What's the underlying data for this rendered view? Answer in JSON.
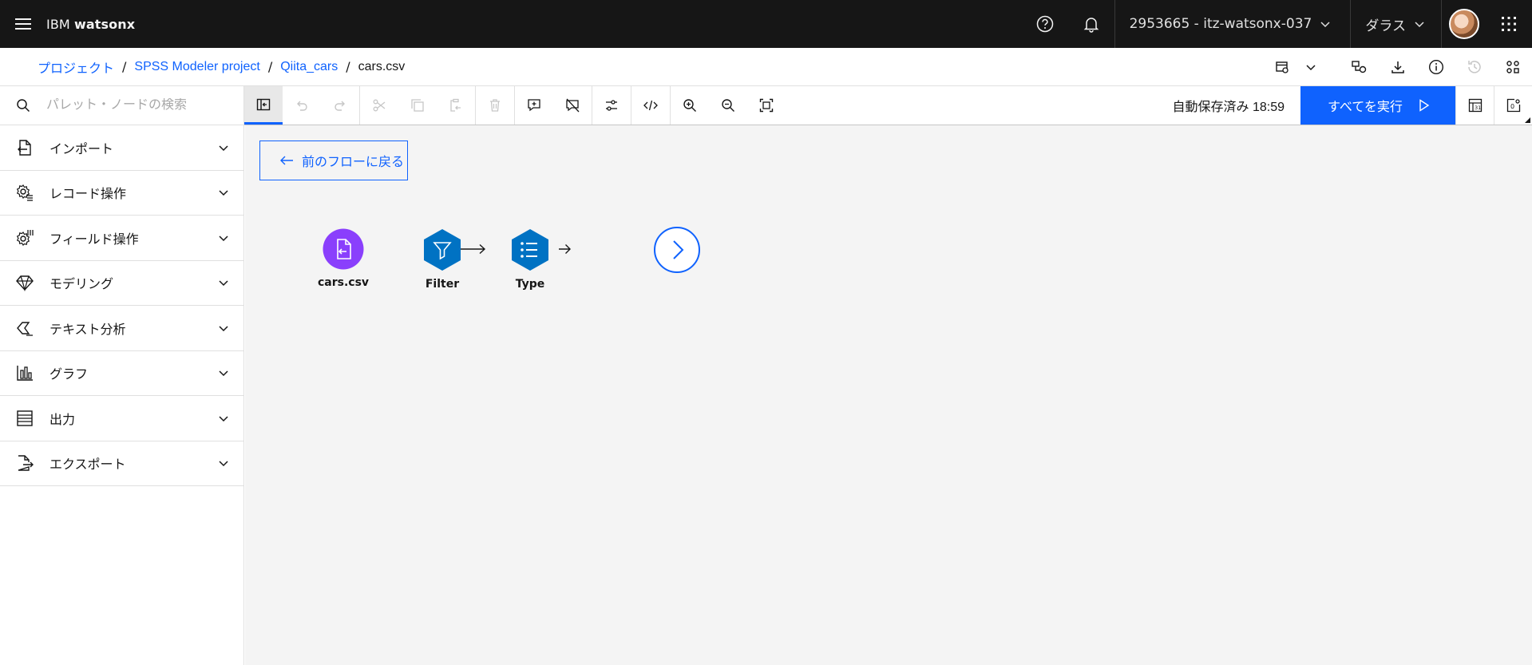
{
  "header": {
    "brand_prefix": "IBM",
    "brand_name": "watsonx",
    "account": "2953665 - itz-watsonx-037",
    "region": "ダラス"
  },
  "breadcrumb": {
    "items": [
      "プロジェクト",
      "SPSS Modeler project",
      "Qiita_cars"
    ],
    "separator": "/",
    "current": "cars.csv"
  },
  "palette": {
    "search_placeholder": "パレット・ノードの検索",
    "categories": [
      {
        "label": "インポート",
        "icon": "import-icon"
      },
      {
        "label": "レコード操作",
        "icon": "record-ops-icon"
      },
      {
        "label": "フィールド操作",
        "icon": "field-ops-icon"
      },
      {
        "label": "モデリング",
        "icon": "modeling-icon"
      },
      {
        "label": "テキスト分析",
        "icon": "text-analysis-icon"
      },
      {
        "label": "グラフ",
        "icon": "graph-icon"
      },
      {
        "label": "出力",
        "icon": "output-icon"
      },
      {
        "label": "エクスポート",
        "icon": "export-icon"
      }
    ]
  },
  "toolbar": {
    "autosave": "自動保存済み 18:59",
    "run_all": "すべてを実行"
  },
  "canvas": {
    "back_button": "前のフローに戻る",
    "nodes": [
      {
        "label": "cars.csv",
        "kind": "import-node",
        "color": "#8a3ffc"
      },
      {
        "label": "Filter",
        "kind": "filter-node",
        "color": "#0072c3"
      },
      {
        "label": "Type",
        "kind": "type-node",
        "color": "#0072c3"
      }
    ]
  },
  "colors": {
    "accent": "#0f62fe",
    "header_bg": "#161616",
    "canvas_bg": "#f4f4f4"
  }
}
